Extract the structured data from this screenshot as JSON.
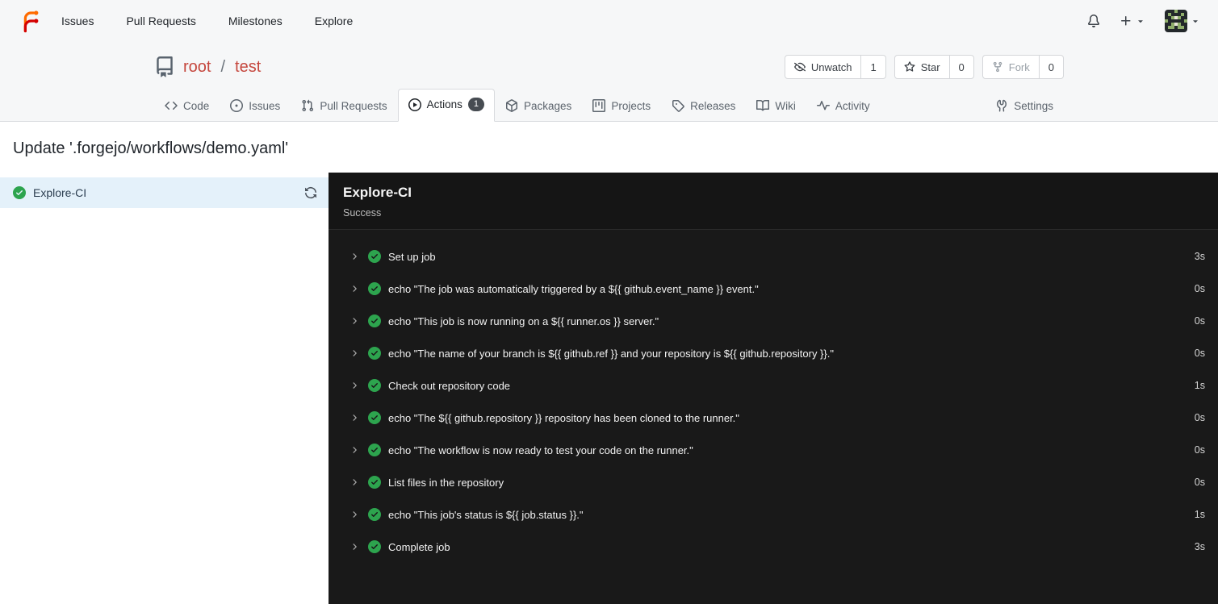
{
  "navbar": {
    "items": [
      "Issues",
      "Pull Requests",
      "Milestones",
      "Explore"
    ],
    "icons": {
      "logo": "forgejo-logo",
      "notifications": "bell-icon",
      "create_new": "plus-icon",
      "expand": "caret-down-icon",
      "user_menu": "avatar"
    }
  },
  "repo_header": {
    "owner": "root",
    "separator": "/",
    "name": "test",
    "buttons": {
      "unwatch": {
        "label": "Unwatch",
        "count": "1"
      },
      "star": {
        "label": "Star",
        "count": "0"
      },
      "fork": {
        "label": "Fork",
        "count": "0"
      }
    }
  },
  "tabs": [
    {
      "label": "Code"
    },
    {
      "label": "Issues"
    },
    {
      "label": "Pull Requests"
    },
    {
      "label": "Actions",
      "badge": "1",
      "active": true
    },
    {
      "label": "Packages"
    },
    {
      "label": "Projects"
    },
    {
      "label": "Releases"
    },
    {
      "label": "Wiki"
    },
    {
      "label": "Activity"
    },
    {
      "label": "Settings"
    }
  ],
  "page": {
    "title": "Update '.forgejo/workflows/demo.yaml'"
  },
  "sidebar": {
    "jobs": [
      {
        "name": "Explore-CI",
        "status": "success"
      }
    ]
  },
  "job_panel": {
    "title": "Explore-CI",
    "status": "Success",
    "steps": [
      {
        "name": "Set up job",
        "duration": "3s"
      },
      {
        "name": "echo \"The job was automatically triggered by a ${{ github.event_name }} event.\"",
        "duration": "0s"
      },
      {
        "name": "echo \"This job is now running on a ${{ runner.os }} server.\"",
        "duration": "0s"
      },
      {
        "name": "echo \"The name of your branch is ${{ github.ref }} and your repository is ${{ github.repository }}.\"",
        "duration": "0s"
      },
      {
        "name": "Check out repository code",
        "duration": "1s"
      },
      {
        "name": "echo \"The ${{ github.repository }} repository has been cloned to the runner.\"",
        "duration": "0s"
      },
      {
        "name": "echo \"The workflow is now ready to test your code on the runner.\"",
        "duration": "0s"
      },
      {
        "name": "List files in the repository",
        "duration": "0s"
      },
      {
        "name": "echo \"This job's status is ${{ job.status }}.\"",
        "duration": "1s"
      },
      {
        "name": "Complete job",
        "duration": "3s"
      }
    ]
  },
  "colors": {
    "accent_red": "#c5463d",
    "success_green": "#2da44e",
    "panel_dark": "#191919",
    "selected_row_blue": "#e4f1fa",
    "header_gray": "#f6f7f8"
  }
}
